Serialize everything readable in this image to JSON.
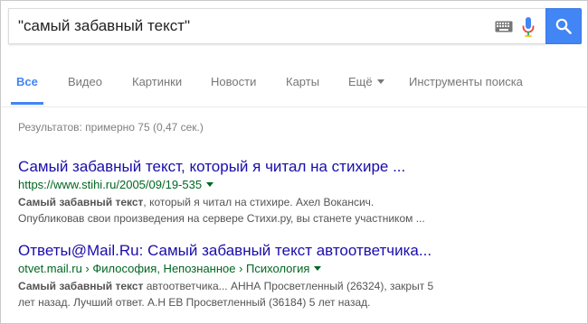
{
  "search": {
    "query": "\"самый забавный текст\"",
    "keyboard_icon": "keyboard-icon",
    "mic_icon": "microphone-icon",
    "search_icon": "magnifier-icon",
    "accent_color": "#4285f4"
  },
  "tabs": [
    {
      "label": "Все",
      "active": true
    },
    {
      "label": "Видео"
    },
    {
      "label": "Картинки"
    },
    {
      "label": "Новости"
    },
    {
      "label": "Карты"
    },
    {
      "label": "Ещё"
    },
    {
      "label": "Инструменты поиска"
    }
  ],
  "stats": "Результатов: примерно 75 (0,47 сек.)",
  "results": [
    {
      "title": "Самый забавный текст, который я читал на стихире ...",
      "url": "https://www.stihi.ru/2005/09/19-535",
      "snippet_bold": "Самый забавный текст",
      "snippet_line1_rest": ", который я читал на стихире. Ахел Вокансич.",
      "snippet_line2": "Опубликовав свои произведения на сервере Стихи.ру, вы станете участником ..."
    },
    {
      "title": "Ответы@Mail.Ru: Самый забавный текст автоответчика...",
      "url": "otvet.mail.ru › Философия, Непознанное › Психология",
      "snippet_bold": "Самый забавный текст",
      "snippet_line1_rest": " автоответчика... АННА Просветленный (26324), закрыт 5",
      "snippet_line2": "лет назад. Лучший ответ. А.Н ЕВ Просветленный (36184) 5 лет назад."
    }
  ]
}
